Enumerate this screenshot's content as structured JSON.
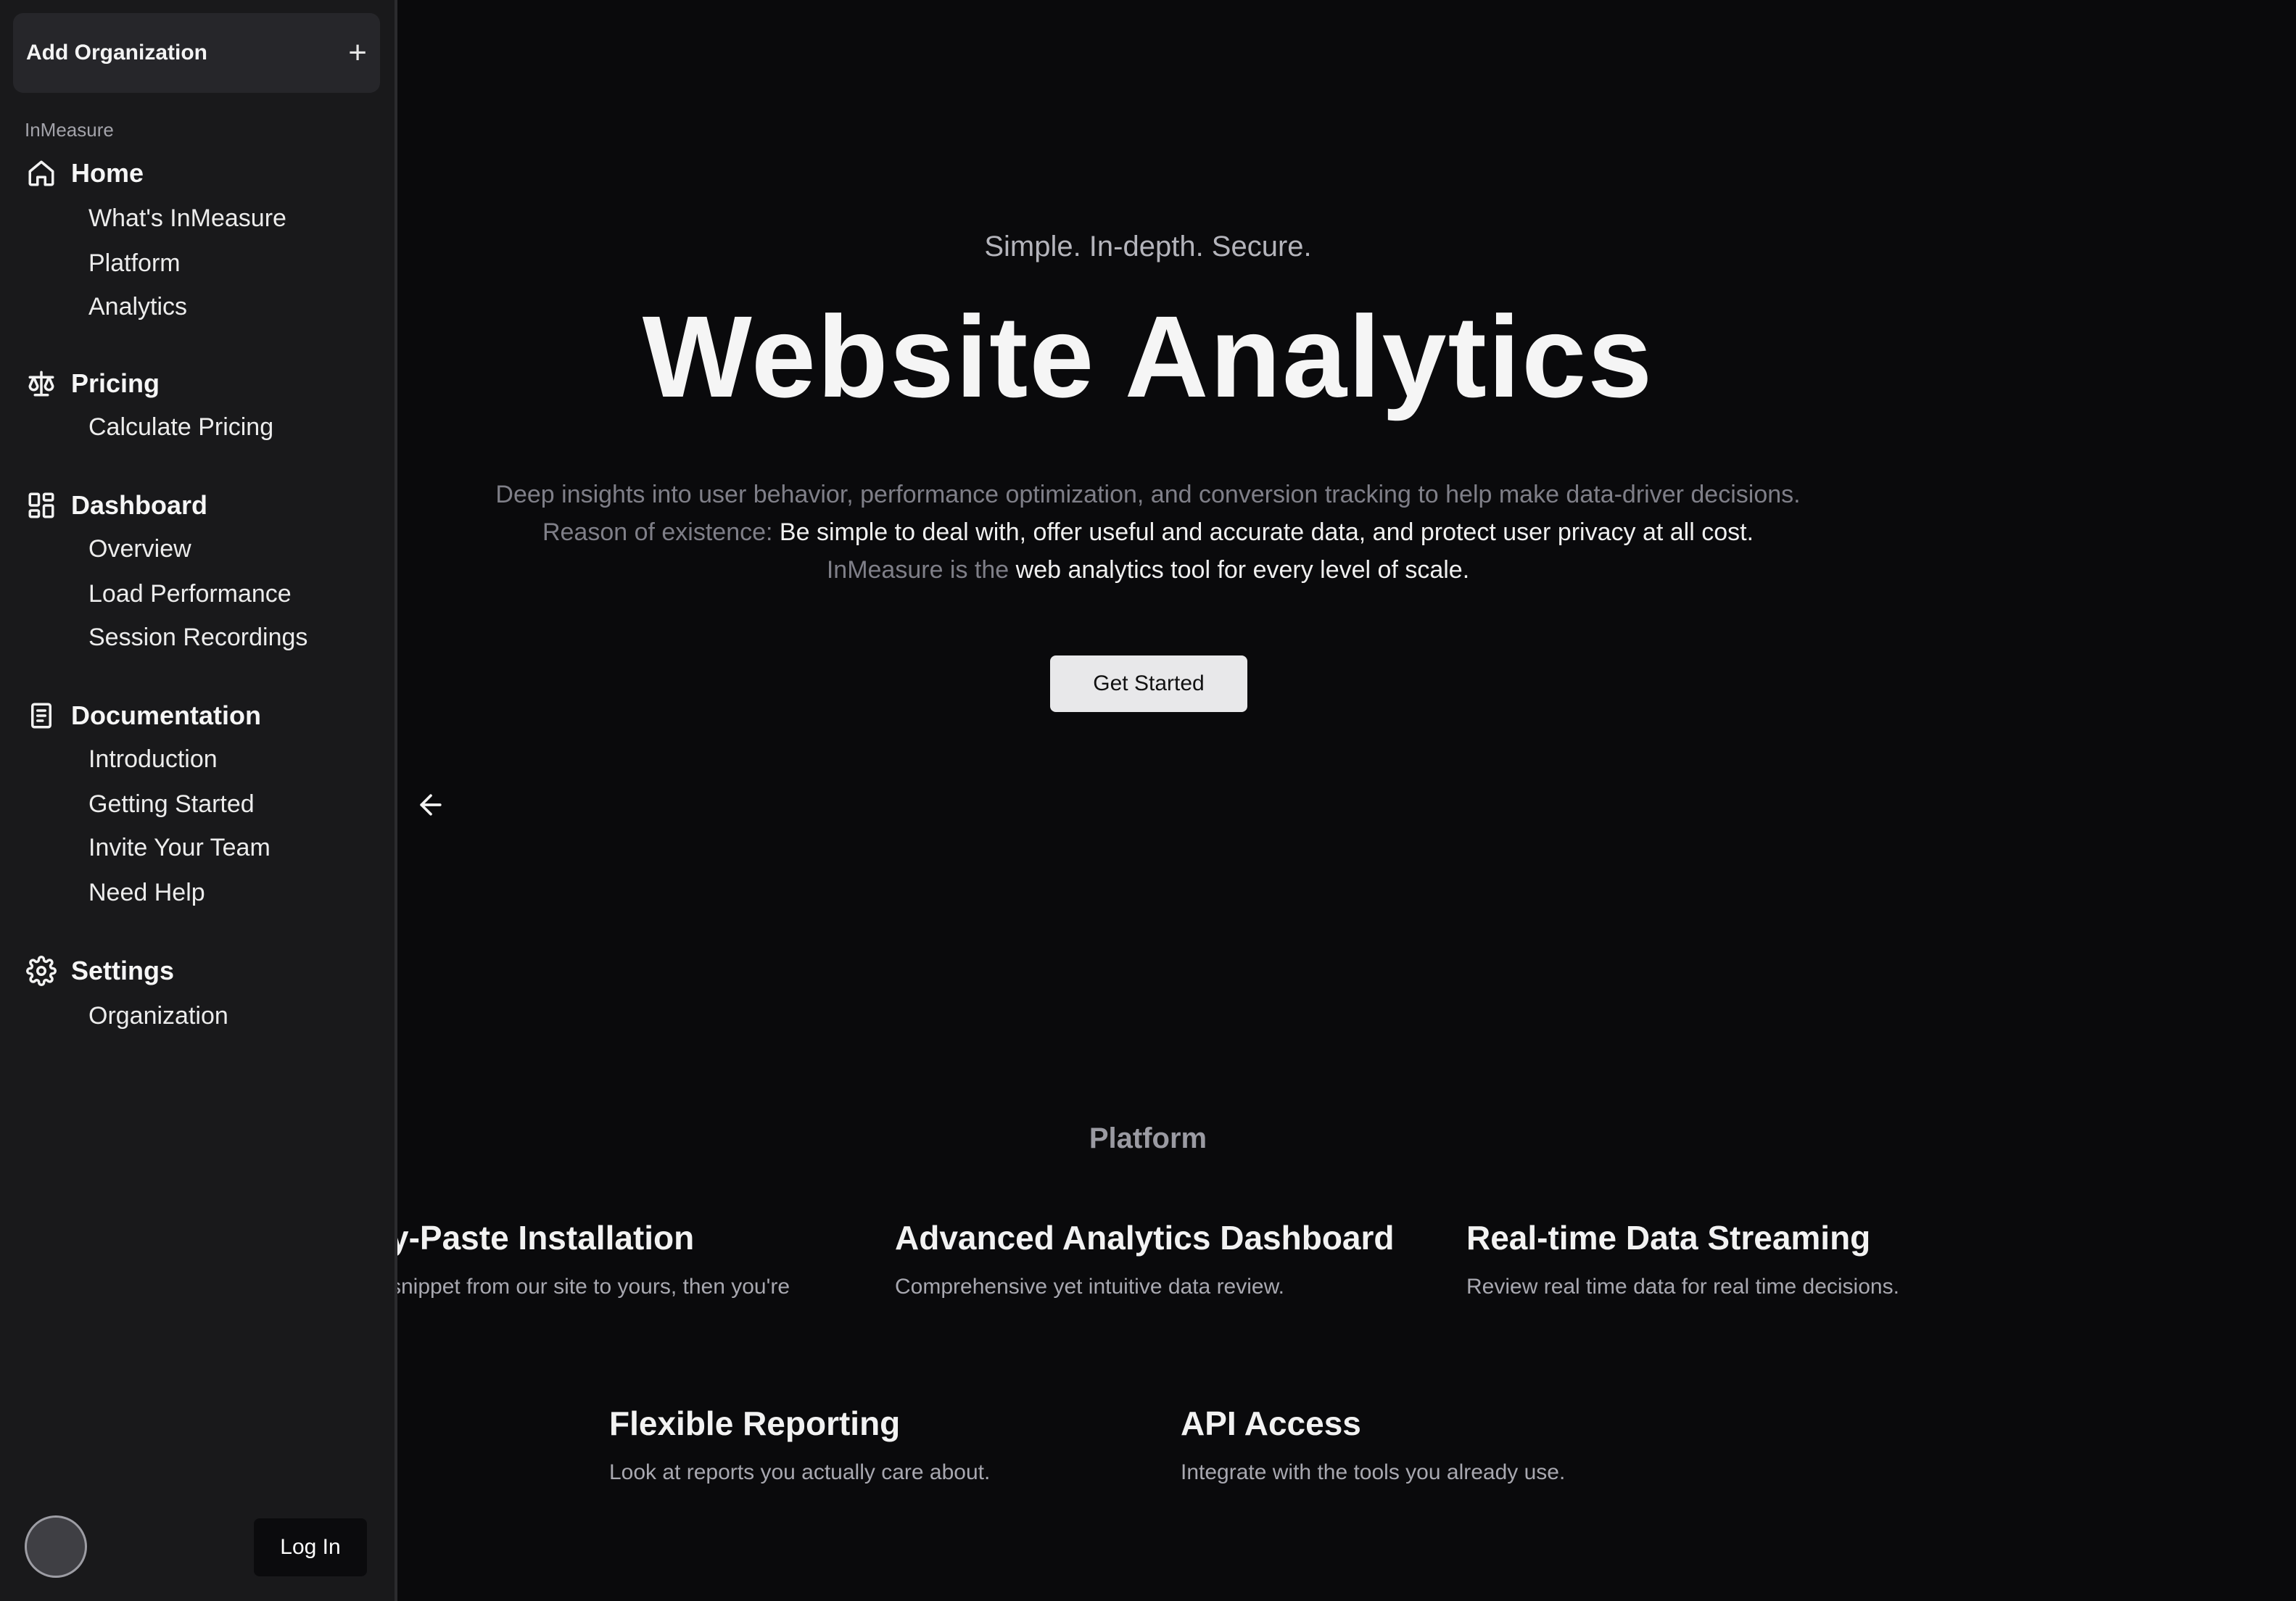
{
  "sidebar": {
    "add_org_label": "Add Organization",
    "group_label": "InMeasure",
    "sections": [
      {
        "label": "Home",
        "icon": "home-icon",
        "items": [
          "What's InMeasure",
          "Platform",
          "Analytics"
        ]
      },
      {
        "label": "Pricing",
        "icon": "scale-icon",
        "items": [
          "Calculate Pricing"
        ]
      },
      {
        "label": "Dashboard",
        "icon": "dashboard-icon",
        "items": [
          "Overview",
          "Load Performance",
          "Session Recordings"
        ]
      },
      {
        "label": "Documentation",
        "icon": "book-icon",
        "items": [
          "Introduction",
          "Getting Started",
          "Invite Your Team",
          "Need Help"
        ]
      },
      {
        "label": "Settings",
        "icon": "gear-icon",
        "items": [
          "Organization"
        ]
      }
    ],
    "login_label": "Log In"
  },
  "hero": {
    "tagline": "Simple. In-depth. Secure.",
    "title": "Website Analytics",
    "desc_line1": "Deep insights into user behavior, performance optimization, and conversion tracking to help make data-driver decisions.",
    "desc_line2_prefix": "Reason of existence: ",
    "desc_line2_main": "Be simple to deal with, offer useful and accurate data, and protect user privacy at all cost.",
    "desc_line3_prefix": "InMeasure is the ",
    "desc_line3_main": "web analytics tool for every level of scale.",
    "cta_label": "Get Started"
  },
  "platform": {
    "title": "Platform",
    "features": [
      {
        "title": "y-Paste Installation",
        "desc": "snippet from our site to yours, then you're"
      },
      {
        "title": "Advanced Analytics Dashboard",
        "desc": "Comprehensive yet intuitive data review."
      },
      {
        "title": "Real-time Data Streaming",
        "desc": "Review real time data for real time decisions."
      },
      {
        "title": "Flexible Reporting",
        "desc": "Look at reports you actually care about."
      },
      {
        "title": "API Access",
        "desc": "Integrate with the tools you already use."
      }
    ]
  },
  "colors": {
    "background": "#0a0a0c",
    "sidebar": "#19191b",
    "button": "#e8e8ea"
  }
}
